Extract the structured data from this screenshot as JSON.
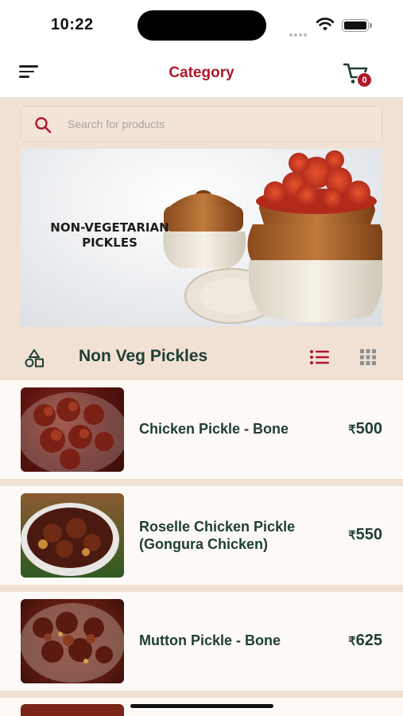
{
  "status_bar": {
    "time": "10:22"
  },
  "header": {
    "title": "Category",
    "cart_count": "0",
    "menu_icon": "menu-icon",
    "cart_icon": "cart-icon"
  },
  "search": {
    "placeholder": "Search for products"
  },
  "banner": {
    "line1": "NON-VEGETARIAN",
    "line2": "PICKLES"
  },
  "section": {
    "title": "Non Veg Pickles",
    "active_view": "list"
  },
  "products": [
    {
      "line1": "Chicken Pickle - Bone",
      "line2": "",
      "currency": "₹",
      "price": "500"
    },
    {
      "line1": "Roselle Chicken Pickle",
      "line2": "(Gongura Chicken)",
      "currency": "₹",
      "price": "550"
    },
    {
      "line1": "Mutton Pickle - Bone",
      "line2": "",
      "currency": "₹",
      "price": "625"
    }
  ],
  "colors": {
    "accent": "#b0182b",
    "text_dark_green": "#1f3e34",
    "background": "#f0e1d4"
  }
}
